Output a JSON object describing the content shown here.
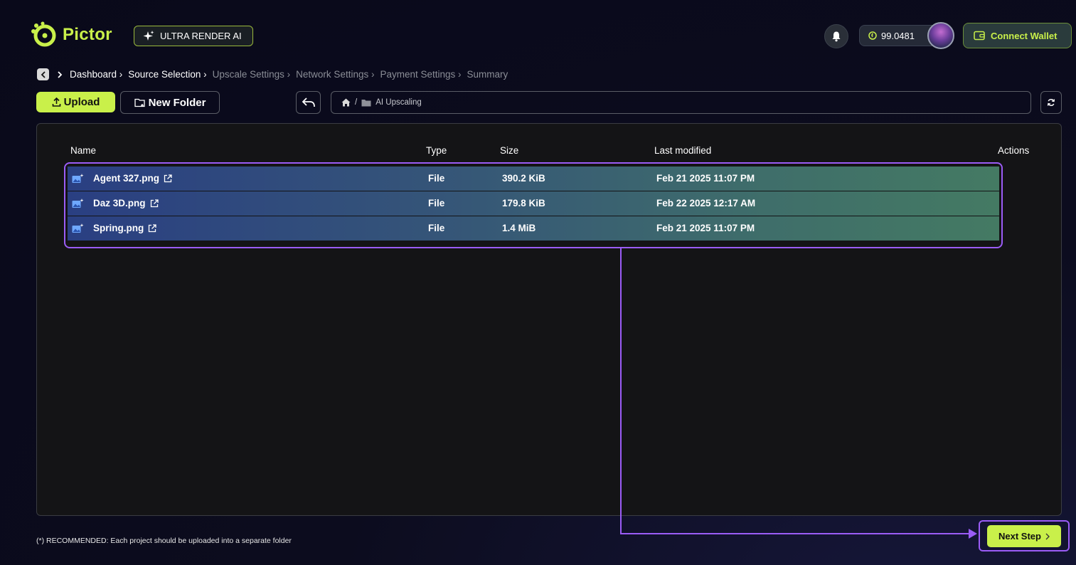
{
  "brand": {
    "name": "Pictor",
    "accent": "#c9f04a"
  },
  "badge": {
    "label": "ULTRA RENDER AI"
  },
  "header": {
    "balance": "99.0481",
    "connect_label": "Connect Wallet"
  },
  "breadcrumb": [
    {
      "label": "Dashboard",
      "active": true
    },
    {
      "label": "Source Selection",
      "active": true
    },
    {
      "label": "Upscale Settings",
      "active": false
    },
    {
      "label": "Network Settings",
      "active": false
    },
    {
      "label": "Payment Settings",
      "active": false
    },
    {
      "label": "Summary",
      "active": false
    }
  ],
  "toolbar": {
    "upload_label": "Upload",
    "new_folder_label": "New Folder",
    "path_separator": "/",
    "current_folder": "AI Upscaling"
  },
  "table": {
    "headers": {
      "name": "Name",
      "type": "Type",
      "size": "Size",
      "modified": "Last modified",
      "actions": "Actions"
    },
    "rows": [
      {
        "name": "Agent 327.png",
        "type": "File",
        "size": "390.2 KiB",
        "modified": "Feb 21 2025 11:07 PM"
      },
      {
        "name": "Daz 3D.png",
        "type": "File",
        "size": "179.8 KiB",
        "modified": "Feb 22 2025 12:17 AM"
      },
      {
        "name": "Spring.png",
        "type": "File",
        "size": "1.4 MiB",
        "modified": "Feb 21 2025 11:07 PM"
      }
    ]
  },
  "footer": {
    "note": "(*) RECOMMENDED: Each project should be uploaded into a separate folder",
    "next_label": "Next Step"
  },
  "colors": {
    "highlight": "#9b5cf6",
    "accent": "#c9f04a"
  }
}
